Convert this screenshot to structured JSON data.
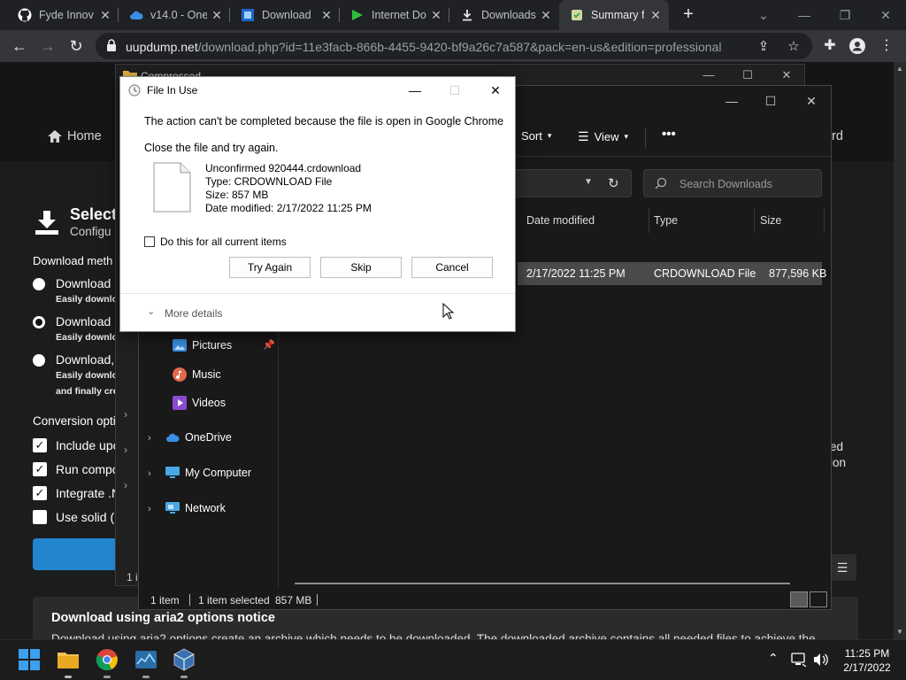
{
  "browser": {
    "tabs": [
      {
        "title": "Fyde Innov",
        "icon": "github-icon"
      },
      {
        "title": "v14.0 - One",
        "icon": "onedrive-icon"
      },
      {
        "title": "Download",
        "icon": "windows-update-icon"
      },
      {
        "title": "Internet Do",
        "icon": "idm-icon"
      },
      {
        "title": "Downloads",
        "icon": "download-icon"
      },
      {
        "title": "Summary f",
        "icon": "summary-icon",
        "active": true
      }
    ],
    "new_tab": "+",
    "url_host": "uupdump.net",
    "url_path": "/download.php?id=11e3facb-866b-4455-9420-bf9a26c7a587&pack=en-us&edition=professional"
  },
  "webpage": {
    "nav_home": "Home",
    "nav_right": "rd",
    "select_title": "Select",
    "select_sub": "Configu",
    "download_method_label": "Download meth",
    "options": [
      {
        "label": "Download",
        "sub": "Easily downlo",
        "selected": false
      },
      {
        "label": "Download",
        "sub": "Easily downlo",
        "selected": true
      },
      {
        "label": "Download,",
        "sub": "Easily downlo",
        "sub2": "and finally cre",
        "selected": false
      }
    ],
    "conversion_label": "Conversion opti",
    "conversions": [
      {
        "label": "Include upo",
        "checked": true
      },
      {
        "label": "Run compo",
        "checked": true
      },
      {
        "label": "Integrate .N",
        "checked": true
      },
      {
        "label": "Use solid (E",
        "checked": false
      }
    ],
    "right_text_1": "ed",
    "right_text_2": "ion",
    "notice_title": "Download using aria2 options notice",
    "notice_text": "Download using aria2 options create an archive which needs to be downloaded. The downloaded archive contains all needed files to achieve the"
  },
  "explorer_back": {
    "title": "Compressed",
    "footer": "1 i"
  },
  "explorer": {
    "commands": {
      "sort": "Sort",
      "view": "View",
      "more": "•••"
    },
    "search_placeholder": "Search Downloads",
    "columns": {
      "date": "Date modified",
      "type": "Type",
      "size": "Size"
    },
    "file": {
      "date": "2/17/2022 11:25 PM",
      "type": "CRDOWNLOAD File",
      "size": "877,596 KB"
    },
    "nav": {
      "pictures": "Pictures",
      "music": "Music",
      "videos": "Videos",
      "onedrive": "OneDrive",
      "mycomputer": "My Computer",
      "network": "Network"
    },
    "status": {
      "count": "1 item",
      "selected": "1 item selected",
      "size": "857 MB"
    }
  },
  "dialog": {
    "title": "File In Use",
    "message": "The action can't be completed because the file is open in Google Chrome",
    "sub": "Close the file and try again.",
    "file_name": "Unconfirmed 920444.crdownload",
    "file_type": "Type: CRDOWNLOAD File",
    "file_size": "Size: 857 MB",
    "file_date": "Date modified: 2/17/2022 11:25 PM",
    "checkbox_label": "Do this for all current items",
    "btn_try_again": "Try Again",
    "btn_skip": "Skip",
    "btn_cancel": "Cancel",
    "more_details": "More details"
  },
  "taskbar": {
    "time": "11:25 PM",
    "date": "2/17/2022"
  },
  "colors": {
    "accent_blue": "#2185d0",
    "chrome_dark": "#202124",
    "selection_gray": "#4a4a4a"
  }
}
